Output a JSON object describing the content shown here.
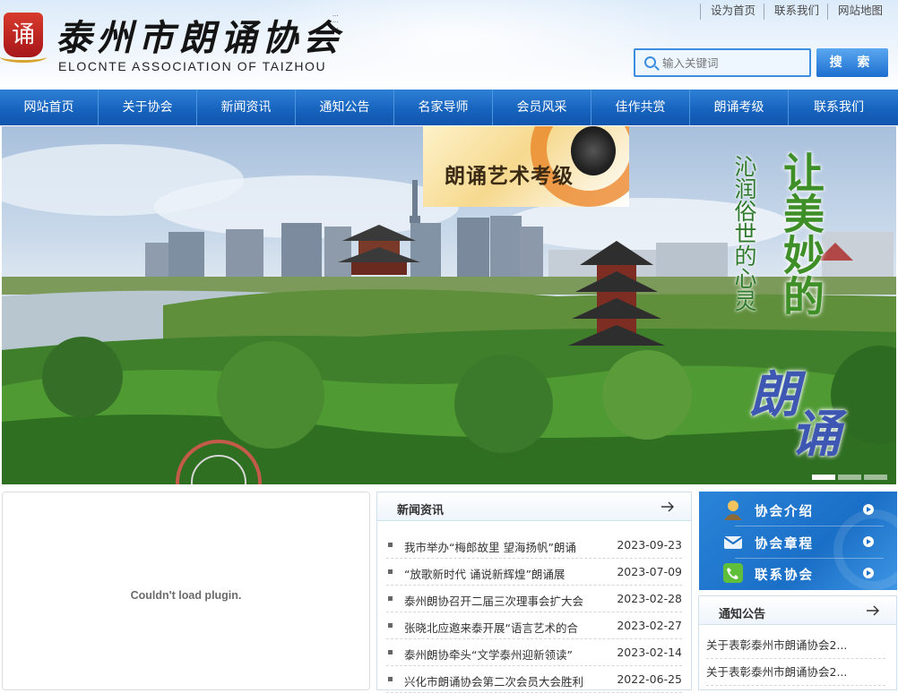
{
  "header": {
    "logo_seal": "诵",
    "logo_cn": "泰州市朗诵协会",
    "logo_en": "ELOCNTE ASSOCIATION OF TAIZHOU",
    "top_links": [
      "设为首页",
      "联系我们",
      "网站地图"
    ],
    "search_placeholder": "输入关键词",
    "search_button": "搜 索"
  },
  "nav": {
    "items": [
      "网站首页",
      "关于协会",
      "新闻资讯",
      "通知公告",
      "名家导师",
      "会员风采",
      "佳作共赏",
      "朗诵考级",
      "联系我们"
    ]
  },
  "banner": {
    "badge_text": "朗诵艺术考级",
    "poem_line": "沁润俗世的心灵",
    "slogan_big": "让美妙的",
    "slogan_big2": [
      "朗",
      "诵"
    ],
    "slide_count": 3,
    "active_slide": 1
  },
  "plugin": {
    "message": "Couldn't load plugin."
  },
  "news": {
    "title": "新闻资讯",
    "items": [
      {
        "title": "我市举办“梅郎故里 望海扬帆”朗诵",
        "date": "2023-09-23"
      },
      {
        "title": "“放歌新时代 诵说新辉煌”朗诵展",
        "date": "2023-07-09"
      },
      {
        "title": "泰州朗协召开二届三次理事会扩大会",
        "date": "2023-02-28"
      },
      {
        "title": "张晓北应邀来泰开展“语言艺术的合",
        "date": "2023-02-27"
      },
      {
        "title": "泰州朗协牵头“文学泰州迎新领读”",
        "date": "2023-02-14"
      },
      {
        "title": "兴化市朗诵协会第二次会员大会胜利",
        "date": "2022-06-25"
      }
    ]
  },
  "quick_links": [
    {
      "label": "协会介绍",
      "icon": "person-icon"
    },
    {
      "label": "协会章程",
      "icon": "envelope-icon"
    },
    {
      "label": "联系协会",
      "icon": "phone-icon"
    }
  ],
  "notices": {
    "title": "通知公告",
    "items": [
      "关于表彰泰州市朗诵协会2...",
      "关于表彰泰州市朗诵协会2..."
    ]
  },
  "colors": {
    "nav_blue": "#1764bf",
    "accent_blue": "#3d8de0",
    "slogan_green": "#3e8f27",
    "slogan_blue": "#3d57b3"
  }
}
